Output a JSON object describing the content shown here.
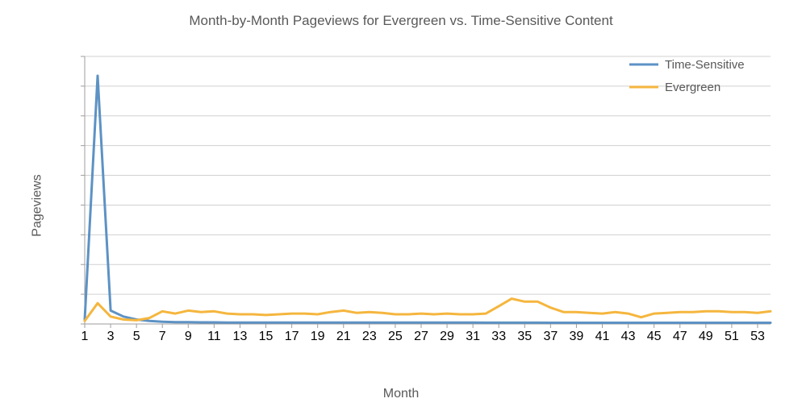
{
  "chart_data": {
    "type": "line",
    "title": "Month-by-Month Pageviews for Evergreen vs. Time-Sensitive Content",
    "xlabel": "Month",
    "ylabel": "Pageviews",
    "ylim": [
      0,
      18000
    ],
    "yticks": [
      0,
      2000,
      4000,
      6000,
      8000,
      10000,
      12000,
      14000,
      16000,
      18000
    ],
    "x": [
      1,
      2,
      3,
      4,
      5,
      6,
      7,
      8,
      9,
      10,
      11,
      12,
      13,
      14,
      15,
      16,
      17,
      18,
      19,
      20,
      21,
      22,
      23,
      24,
      25,
      26,
      27,
      28,
      29,
      30,
      31,
      32,
      33,
      34,
      35,
      36,
      37,
      38,
      39,
      40,
      41,
      42,
      43,
      44,
      45,
      46,
      47,
      48,
      49,
      50,
      51,
      52,
      53,
      54
    ],
    "xticks": [
      1,
      3,
      5,
      7,
      9,
      11,
      13,
      15,
      17,
      19,
      21,
      23,
      25,
      27,
      29,
      31,
      33,
      35,
      37,
      39,
      41,
      43,
      45,
      47,
      49,
      51,
      53
    ],
    "series": [
      {
        "name": "Time-Sensitive",
        "color": "#5D92C4",
        "values": [
          300,
          16700,
          900,
          500,
          300,
          200,
          150,
          120,
          120,
          110,
          110,
          100,
          100,
          100,
          100,
          100,
          100,
          100,
          100,
          100,
          100,
          95,
          95,
          95,
          90,
          90,
          90,
          90,
          90,
          90,
          90,
          85,
          85,
          85,
          85,
          85,
          80,
          80,
          80,
          80,
          80,
          80,
          80,
          80,
          80,
          80,
          80,
          80,
          80,
          80,
          80,
          80,
          80,
          80
        ]
      },
      {
        "name": "Evergreen",
        "color": "#F5B63E",
        "values": [
          200,
          1400,
          500,
          300,
          250,
          400,
          850,
          700,
          900,
          800,
          850,
          700,
          650,
          650,
          600,
          650,
          700,
          700,
          650,
          800,
          900,
          750,
          800,
          750,
          650,
          650,
          700,
          650,
          700,
          650,
          650,
          700,
          1200,
          1700,
          1500,
          1500,
          1100,
          800,
          800,
          750,
          700,
          800,
          700,
          450,
          700,
          750,
          800,
          800,
          850,
          850,
          800,
          800,
          750,
          850
        ]
      }
    ],
    "legend": {
      "entries": [
        "Time-Sensitive",
        "Evergreen"
      ],
      "position": "top-right"
    }
  }
}
